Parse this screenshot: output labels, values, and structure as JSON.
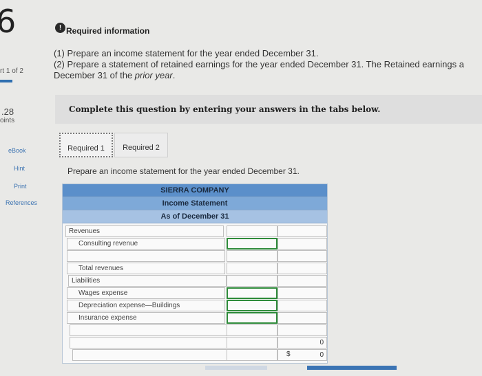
{
  "left_panel": {
    "question_number": "6",
    "part_label": "rt 1 of 2",
    "points_value": ".28",
    "points_label": "oints",
    "links": [
      "eBook",
      "Hint",
      "Print",
      "References"
    ]
  },
  "header": {
    "info_icon": "exclamation-icon",
    "info_title": "Required information"
  },
  "instructions": {
    "line1": "(1) Prepare an income statement for the year ended December 31.",
    "line2": "(2) Prepare a statement of retained earnings for the year ended December 31. The Retained earnings a",
    "line3_prefix": "December 31 of the ",
    "line3_italic": "prior year",
    "line3_suffix": "."
  },
  "complete_text": "Complete this question by entering your answers in the tabs below.",
  "tabs": [
    {
      "label": "Required 1",
      "active": true
    },
    {
      "label": "Required 2",
      "active": false
    }
  ],
  "prompt": "Prepare an income statement for the year ended December 31.",
  "statement": {
    "company": "SIERRA COMPANY",
    "title": "Income Statement",
    "date": "As of December 31",
    "rows": [
      {
        "label": "Revenues",
        "value": ""
      },
      {
        "label": "Consulting revenue",
        "value": ""
      },
      {
        "label": "",
        "value": ""
      },
      {
        "label": "Total revenues",
        "value": ""
      },
      {
        "label": "Liabilities",
        "value": ""
      },
      {
        "label": "Wages expense",
        "value": ""
      },
      {
        "label": "Depreciation expense—Buildings",
        "value": ""
      },
      {
        "label": "Insurance expense",
        "value": ""
      },
      {
        "label": "",
        "value": ""
      },
      {
        "label": "",
        "value": "0"
      },
      {
        "label": "",
        "value": "0",
        "currency": "$"
      }
    ]
  },
  "colors": {
    "header_dark": "#5b8fca",
    "header_mid": "#7ea9d8",
    "header_light": "#a6c2e3",
    "input_border_green": "#2e8b3a",
    "link_blue": "#1f5fa8"
  }
}
